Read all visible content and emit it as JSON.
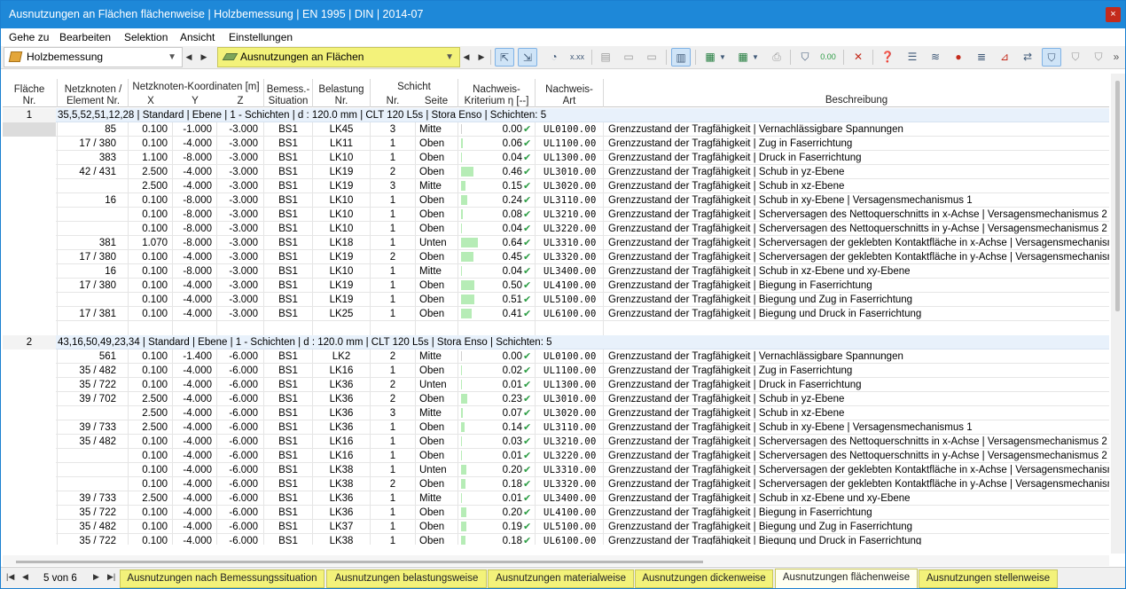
{
  "window": {
    "title": "Ausnutzungen an Flächen flächenweise | Holzbemessung | EN 1995 | DIN | 2014-07",
    "close_glyph": "×"
  },
  "menu": [
    "Gehe zu",
    "Bearbeiten",
    "Selektion",
    "Ansicht",
    "Einstellungen"
  ],
  "toolbar": {
    "module_label": "Holzbemessung",
    "result_label": "Ausnutzungen an Flächen",
    "more_glyph": "»"
  },
  "colors": {
    "title": "#1e88d8",
    "highlight": "#f3f27a",
    "check": "#2e9e46",
    "bar": "#b6ecb6"
  },
  "headers": {
    "flaeche": [
      "Fläche",
      "Nr."
    ],
    "knoten": [
      "Netzknoten /",
      "Element Nr."
    ],
    "coord_group": "Netzknoten-Koordinaten [m]",
    "x": "X",
    "y": "Y",
    "z": "Z",
    "situation": [
      "Bemess.-",
      "Situation"
    ],
    "belastung": [
      "Belastung",
      "Nr."
    ],
    "schicht_group": "Schicht",
    "schicht_nr": "Nr.",
    "schicht_seite": "Seite",
    "kriterium": [
      "Nachweis-",
      "Kriterium η [--]"
    ],
    "art": [
      "Nachweis-",
      "Art"
    ],
    "beschreibung": "Beschreibung"
  },
  "groups": [
    {
      "nr": "1",
      "header": "35,5,52,51,12,28 | Standard | Ebene | 1 - Schichten | d : 120.0 mm | CLT 120 L5s | Stora Enso | Schichten: 5",
      "rows": [
        {
          "el": "85",
          "x": "0.100",
          "y": "-1.000",
          "z": "-3.000",
          "bs": "BS1",
          "lk": "LK45",
          "sn": "3",
          "seite": "Mitte",
          "eta": "0.00",
          "etav": 0.0,
          "art": "UL0100.00",
          "desc": "Grenzzustand der Tragfähigkeit | Vernachlässigbare Spannungen"
        },
        {
          "el": "17 / 380",
          "x": "0.100",
          "y": "-4.000",
          "z": "-3.000",
          "bs": "BS1",
          "lk": "LK11",
          "sn": "1",
          "seite": "Oben",
          "eta": "0.06",
          "etav": 0.06,
          "art": "UL1100.00",
          "desc": "Grenzzustand der Tragfähigkeit | Zug in Faserrichtung"
        },
        {
          "el": "383",
          "x": "1.100",
          "y": "-8.000",
          "z": "-3.000",
          "bs": "BS1",
          "lk": "LK10",
          "sn": "1",
          "seite": "Oben",
          "eta": "0.04",
          "etav": 0.04,
          "art": "UL1300.00",
          "desc": "Grenzzustand der Tragfähigkeit | Druck in Faserrichtung"
        },
        {
          "el": "42 / 431",
          "x": "2.500",
          "y": "-4.000",
          "z": "-3.000",
          "bs": "BS1",
          "lk": "LK19",
          "sn": "2",
          "seite": "Oben",
          "eta": "0.46",
          "etav": 0.46,
          "art": "UL3010.00",
          "desc": "Grenzzustand der Tragfähigkeit | Schub in yz-Ebene"
        },
        {
          "el": "",
          "x": "2.500",
          "y": "-4.000",
          "z": "-3.000",
          "bs": "BS1",
          "lk": "LK19",
          "sn": "3",
          "seite": "Mitte",
          "eta": "0.15",
          "etav": 0.15,
          "art": "UL3020.00",
          "desc": "Grenzzustand der Tragfähigkeit | Schub in xz-Ebene"
        },
        {
          "el": "16",
          "x": "0.100",
          "y": "-8.000",
          "z": "-3.000",
          "bs": "BS1",
          "lk": "LK10",
          "sn": "1",
          "seite": "Oben",
          "eta": "0.24",
          "etav": 0.24,
          "art": "UL3110.00",
          "desc": "Grenzzustand der Tragfähigkeit | Schub in xy-Ebene | Versagensmechanismus 1"
        },
        {
          "el": "",
          "x": "0.100",
          "y": "-8.000",
          "z": "-3.000",
          "bs": "BS1",
          "lk": "LK10",
          "sn": "1",
          "seite": "Oben",
          "eta": "0.08",
          "etav": 0.08,
          "art": "UL3210.00",
          "desc": "Grenzzustand der Tragfähigkeit | Scherversagen des Nettoquerschnitts in x-Achse | Versagensmechanismus 2"
        },
        {
          "el": "",
          "x": "0.100",
          "y": "-8.000",
          "z": "-3.000",
          "bs": "BS1",
          "lk": "LK10",
          "sn": "1",
          "seite": "Oben",
          "eta": "0.04",
          "etav": 0.04,
          "art": "UL3220.00",
          "desc": "Grenzzustand der Tragfähigkeit | Scherversagen des Nettoquerschnitts in y-Achse | Versagensmechanismus 2"
        },
        {
          "el": "381",
          "x": "1.070",
          "y": "-8.000",
          "z": "-3.000",
          "bs": "BS1",
          "lk": "LK18",
          "sn": "1",
          "seite": "Unten",
          "eta": "0.64",
          "etav": 0.64,
          "art": "UL3310.00",
          "desc": "Grenzzustand der Tragfähigkeit | Scherversagen der geklebten Kontaktfläche in x-Achse | Versagensmechanism"
        },
        {
          "el": "17 / 380",
          "x": "0.100",
          "y": "-4.000",
          "z": "-3.000",
          "bs": "BS1",
          "lk": "LK19",
          "sn": "2",
          "seite": "Oben",
          "eta": "0.45",
          "etav": 0.45,
          "art": "UL3320.00",
          "desc": "Grenzzustand der Tragfähigkeit | Scherversagen der geklebten Kontaktfläche in y-Achse | Versagensmechanism"
        },
        {
          "el": "16",
          "x": "0.100",
          "y": "-8.000",
          "z": "-3.000",
          "bs": "BS1",
          "lk": "LK10",
          "sn": "1",
          "seite": "Mitte",
          "eta": "0.04",
          "etav": 0.04,
          "art": "UL3400.00",
          "desc": "Grenzzustand der Tragfähigkeit | Schub in xz-Ebene und xy-Ebene"
        },
        {
          "el": "17 / 380",
          "x": "0.100",
          "y": "-4.000",
          "z": "-3.000",
          "bs": "BS1",
          "lk": "LK19",
          "sn": "1",
          "seite": "Oben",
          "eta": "0.50",
          "etav": 0.5,
          "art": "UL4100.00",
          "desc": "Grenzzustand der Tragfähigkeit | Biegung in Faserrichtung"
        },
        {
          "el": "",
          "x": "0.100",
          "y": "-4.000",
          "z": "-3.000",
          "bs": "BS1",
          "lk": "LK19",
          "sn": "1",
          "seite": "Oben",
          "eta": "0.51",
          "etav": 0.51,
          "art": "UL5100.00",
          "desc": "Grenzzustand der Tragfähigkeit | Biegung und Zug in Faserrichtung"
        },
        {
          "el": "17 / 381",
          "x": "0.100",
          "y": "-4.000",
          "z": "-3.000",
          "bs": "BS1",
          "lk": "LK25",
          "sn": "1",
          "seite": "Oben",
          "eta": "0.41",
          "etav": 0.41,
          "art": "UL6100.00",
          "desc": "Grenzzustand der Tragfähigkeit | Biegung und Druck in Faserrichtung"
        }
      ]
    },
    {
      "nr": "2",
      "header": "43,16,50,49,23,34 | Standard | Ebene | 1 - Schichten | d : 120.0 mm | CLT 120 L5s | Stora Enso | Schichten: 5",
      "rows": [
        {
          "el": "561",
          "x": "0.100",
          "y": "-1.400",
          "z": "-6.000",
          "bs": "BS1",
          "lk": "LK2",
          "sn": "2",
          "seite": "Mitte",
          "eta": "0.00",
          "etav": 0.0,
          "art": "UL0100.00",
          "desc": "Grenzzustand der Tragfähigkeit | Vernachlässigbare Spannungen"
        },
        {
          "el": "35 / 482",
          "x": "0.100",
          "y": "-4.000",
          "z": "-6.000",
          "bs": "BS1",
          "lk": "LK16",
          "sn": "1",
          "seite": "Oben",
          "eta": "0.02",
          "etav": 0.02,
          "art": "UL1100.00",
          "desc": "Grenzzustand der Tragfähigkeit | Zug in Faserrichtung"
        },
        {
          "el": "35 / 722",
          "x": "0.100",
          "y": "-4.000",
          "z": "-6.000",
          "bs": "BS1",
          "lk": "LK36",
          "sn": "2",
          "seite": "Unten",
          "eta": "0.01",
          "etav": 0.01,
          "art": "UL1300.00",
          "desc": "Grenzzustand der Tragfähigkeit | Druck in Faserrichtung"
        },
        {
          "el": "39 / 702",
          "x": "2.500",
          "y": "-4.000",
          "z": "-6.000",
          "bs": "BS1",
          "lk": "LK36",
          "sn": "2",
          "seite": "Oben",
          "eta": "0.23",
          "etav": 0.23,
          "art": "UL3010.00",
          "desc": "Grenzzustand der Tragfähigkeit | Schub in yz-Ebene"
        },
        {
          "el": "",
          "x": "2.500",
          "y": "-4.000",
          "z": "-6.000",
          "bs": "BS1",
          "lk": "LK36",
          "sn": "3",
          "seite": "Mitte",
          "eta": "0.07",
          "etav": 0.07,
          "art": "UL3020.00",
          "desc": "Grenzzustand der Tragfähigkeit | Schub in xz-Ebene"
        },
        {
          "el": "39 / 733",
          "x": "2.500",
          "y": "-4.000",
          "z": "-6.000",
          "bs": "BS1",
          "lk": "LK36",
          "sn": "1",
          "seite": "Oben",
          "eta": "0.14",
          "etav": 0.14,
          "art": "UL3110.00",
          "desc": "Grenzzustand der Tragfähigkeit | Schub in xy-Ebene | Versagensmechanismus 1"
        },
        {
          "el": "35 / 482",
          "x": "0.100",
          "y": "-4.000",
          "z": "-6.000",
          "bs": "BS1",
          "lk": "LK16",
          "sn": "1",
          "seite": "Oben",
          "eta": "0.03",
          "etav": 0.03,
          "art": "UL3210.00",
          "desc": "Grenzzustand der Tragfähigkeit | Scherversagen des Nettoquerschnitts in x-Achse | Versagensmechanismus 2"
        },
        {
          "el": "",
          "x": "0.100",
          "y": "-4.000",
          "z": "-6.000",
          "bs": "BS1",
          "lk": "LK16",
          "sn": "1",
          "seite": "Oben",
          "eta": "0.01",
          "etav": 0.01,
          "art": "UL3220.00",
          "desc": "Grenzzustand der Tragfähigkeit | Scherversagen des Nettoquerschnitts in y-Achse | Versagensmechanismus 2"
        },
        {
          "el": "",
          "x": "0.100",
          "y": "-4.000",
          "z": "-6.000",
          "bs": "BS1",
          "lk": "LK38",
          "sn": "1",
          "seite": "Unten",
          "eta": "0.20",
          "etav": 0.2,
          "art": "UL3310.00",
          "desc": "Grenzzustand der Tragfähigkeit | Scherversagen der geklebten Kontaktfläche in x-Achse | Versagensmechanism"
        },
        {
          "el": "",
          "x": "0.100",
          "y": "-4.000",
          "z": "-6.000",
          "bs": "BS1",
          "lk": "LK38",
          "sn": "2",
          "seite": "Oben",
          "eta": "0.18",
          "etav": 0.18,
          "art": "UL3320.00",
          "desc": "Grenzzustand der Tragfähigkeit | Scherversagen der geklebten Kontaktfläche in y-Achse | Versagensmechanism"
        },
        {
          "el": "39 / 733",
          "x": "2.500",
          "y": "-4.000",
          "z": "-6.000",
          "bs": "BS1",
          "lk": "LK36",
          "sn": "1",
          "seite": "Mitte",
          "eta": "0.01",
          "etav": 0.01,
          "art": "UL3400.00",
          "desc": "Grenzzustand der Tragfähigkeit | Schub in xz-Ebene und xy-Ebene"
        },
        {
          "el": "35 / 722",
          "x": "0.100",
          "y": "-4.000",
          "z": "-6.000",
          "bs": "BS1",
          "lk": "LK36",
          "sn": "1",
          "seite": "Oben",
          "eta": "0.20",
          "etav": 0.2,
          "art": "UL4100.00",
          "desc": "Grenzzustand der Tragfähigkeit | Biegung in Faserrichtung"
        },
        {
          "el": "35 / 482",
          "x": "0.100",
          "y": "-4.000",
          "z": "-6.000",
          "bs": "BS1",
          "lk": "LK37",
          "sn": "1",
          "seite": "Oben",
          "eta": "0.19",
          "etav": 0.19,
          "art": "UL5100.00",
          "desc": "Grenzzustand der Tragfähigkeit | Biegung und Zug in Faserrichtung"
        },
        {
          "el": "35 / 722",
          "x": "0.100",
          "y": "-4.000",
          "z": "-6.000",
          "bs": "BS1",
          "lk": "LK38",
          "sn": "1",
          "seite": "Oben",
          "eta": "0.18",
          "etav": 0.18,
          "art": "UL6100.00",
          "desc": "Grenzzustand der Tragfähigkeit | Biegung und Druck in Faserrichtung"
        }
      ]
    }
  ],
  "pager": {
    "label": "5 von 6"
  },
  "tabs": [
    {
      "label": "Ausnutzungen nach Bemessungssituation",
      "active": false
    },
    {
      "label": "Ausnutzungen belastungsweise",
      "active": false
    },
    {
      "label": "Ausnutzungen materialweise",
      "active": false
    },
    {
      "label": "Ausnutzungen dickenweise",
      "active": false
    },
    {
      "label": "Ausnutzungen flächenweise",
      "active": true
    },
    {
      "label": "Ausnutzungen stellenweise",
      "active": false
    }
  ]
}
